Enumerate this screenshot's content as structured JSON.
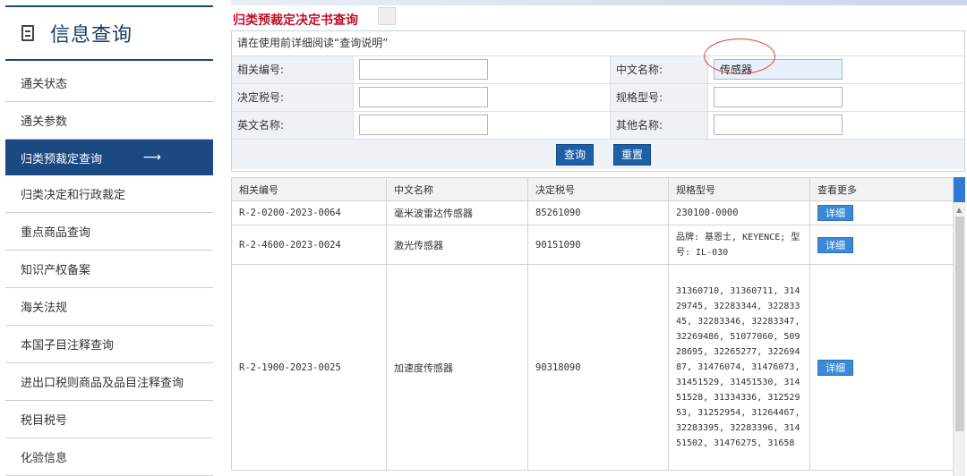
{
  "sidebar": {
    "title": "信息查询",
    "items": [
      {
        "label": "通关状态"
      },
      {
        "label": "通关参数"
      },
      {
        "label": "归类预裁定查询",
        "arrow": "⟶"
      },
      {
        "label": "归类决定和行政裁定"
      },
      {
        "label": "重点商品查询"
      },
      {
        "label": "知识产权备案"
      },
      {
        "label": "海关法规"
      },
      {
        "label": "本国子目注释查询"
      },
      {
        "label": "进出口税则商品及品目注释查询"
      },
      {
        "label": "税目税号"
      },
      {
        "label": "化验信息"
      }
    ]
  },
  "page": {
    "title": "归类预裁定决定书查询"
  },
  "form": {
    "notice": "请在使用前详细阅读“查询说明”",
    "fields": {
      "ref_no": {
        "label": "相关编号:",
        "value": ""
      },
      "cn_name": {
        "label": "中文名称:",
        "value": "传感器"
      },
      "tax_no": {
        "label": "决定税号:",
        "value": ""
      },
      "spec": {
        "label": "规格型号:",
        "value": ""
      },
      "en_name": {
        "label": "英文名称:",
        "value": ""
      },
      "other_name": {
        "label": "其他名称:",
        "value": ""
      }
    },
    "query_label": "查询",
    "reset_label": "重置"
  },
  "table": {
    "headers": [
      "相关编号",
      "中文名称",
      "决定税号",
      "规格型号",
      "查看更多"
    ],
    "rows": [
      {
        "ref": "R-2-0200-2023-0064",
        "name": "毫米波雷达传感器",
        "tax": "85261090",
        "spec": "230100-0000",
        "more": "详细"
      },
      {
        "ref": "R-2-4600-2023-0024",
        "name": "激光传感器",
        "tax": "90151090",
        "spec": "品牌: 基恩士, KEYENCE; 型号: IL-030",
        "more": "详细"
      },
      {
        "ref": "R-2-1900-2023-0025",
        "name": "加速度传感器",
        "tax": "90318090",
        "spec": "31360710, 31360711, 31429745, 32283344, 32283345, 32283346, 32283347, 32269486, 51077060, 50928695, 32265277, 32269487, 31476074, 31476073, 31451529, 31451530, 31451528, 31334336, 31252953, 31252954, 31264467, 32283395, 32283396, 31451502, 31476275, 31658",
        "more": "详细"
      }
    ]
  }
}
